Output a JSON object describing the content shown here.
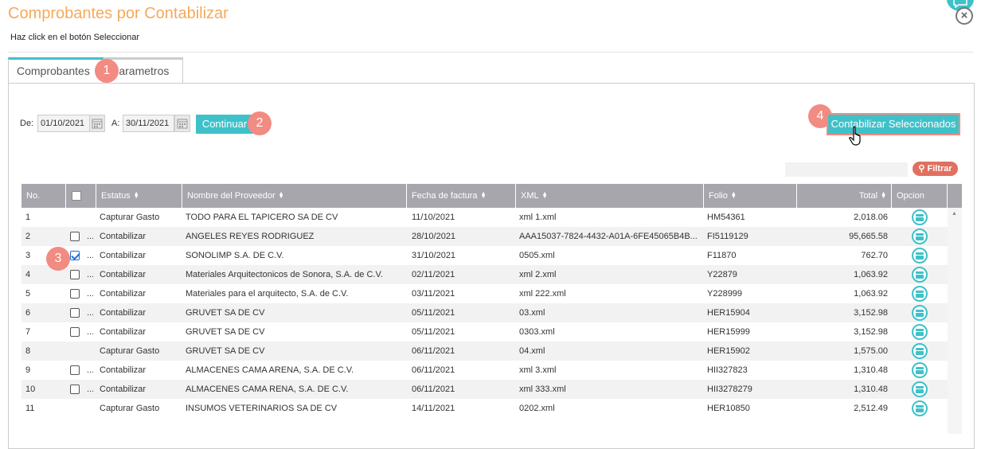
{
  "header": {
    "title": "Comprobantes por Contabilizar",
    "subtitle": "Haz click en el botón Seleccionar",
    "close_glyph": "×"
  },
  "tabs": [
    {
      "label": "Comprobantes",
      "active": true
    },
    {
      "label": "Parametros",
      "active": false
    }
  ],
  "badges": [
    "1",
    "2",
    "3",
    "4"
  ],
  "filters": {
    "from_label": "De:",
    "from_value": "01/10/2021",
    "to_label": "A:",
    "to_value": "30/11/2021",
    "continue_label": "Continuar"
  },
  "actions": {
    "contabilizar_label": "Contabilizar Seleccionados",
    "filter_label": "Filtrar",
    "filter_placeholder": ""
  },
  "table": {
    "columns": [
      "No.",
      "",
      "Estatus",
      "Nombre del Proveedor",
      "Fecha de factura",
      "XML",
      "Folio",
      "Total",
      "Opcion"
    ],
    "rows": [
      {
        "no": "1",
        "checkbox": false,
        "has_checkbox": false,
        "dots": "",
        "estatus": "Capturar Gasto",
        "proveedor": "TODO PARA EL TAPICERO SA DE CV",
        "fecha": "11/10/2021",
        "xml": "xml 1.xml",
        "folio": "HM54361",
        "total": "2,018.06"
      },
      {
        "no": "2",
        "checkbox": false,
        "has_checkbox": true,
        "dots": "...",
        "estatus": "Contabilizar",
        "proveedor": "ANGELES REYES RODRIGUEZ",
        "fecha": "28/10/2021",
        "xml": "AAA15037-7824-4432-A01A-6FE45065B4B...",
        "folio": "FI5119129",
        "total": "95,665.58"
      },
      {
        "no": "3",
        "checkbox": true,
        "has_checkbox": true,
        "dots": "...",
        "estatus": "Contabilizar",
        "proveedor": "SONOLIMP S.A. DE C.V.",
        "fecha": "31/10/2021",
        "xml": "0505.xml",
        "folio": "F11870",
        "total": "762.70"
      },
      {
        "no": "4",
        "checkbox": false,
        "has_checkbox": true,
        "dots": "...",
        "estatus": "Contabilizar",
        "proveedor": "Materiales Arquitectonicos de Sonora, S.A. de C.V.",
        "fecha": "02/11/2021",
        "xml": "xml 2.xml",
        "folio": "Y22879",
        "total": "1,063.92"
      },
      {
        "no": "5",
        "checkbox": false,
        "has_checkbox": true,
        "dots": "...",
        "estatus": "Contabilizar",
        "proveedor": "Materiales para el arquitecto, S.A. de C.V.",
        "fecha": "03/11/2021",
        "xml": "xml 222.xml",
        "folio": "Y228999",
        "total": "1,063.92"
      },
      {
        "no": "6",
        "checkbox": false,
        "has_checkbox": true,
        "dots": "...",
        "estatus": "Contabilizar",
        "proveedor": "GRUVET SA DE CV",
        "fecha": "05/11/2021",
        "xml": "03.xml",
        "folio": "HER15904",
        "total": "3,152.98"
      },
      {
        "no": "7",
        "checkbox": false,
        "has_checkbox": true,
        "dots": "...",
        "estatus": "Contabilizar",
        "proveedor": "GRUVET SA DE CV",
        "fecha": "05/11/2021",
        "xml": "0303.xml",
        "folio": "HER15999",
        "total": "3,152.98"
      },
      {
        "no": "8",
        "checkbox": false,
        "has_checkbox": false,
        "dots": "",
        "estatus": "Capturar Gasto",
        "proveedor": "GRUVET SA DE CV",
        "fecha": "06/11/2021",
        "xml": "04.xml",
        "folio": "HER15902",
        "total": "1,575.00"
      },
      {
        "no": "9",
        "checkbox": false,
        "has_checkbox": true,
        "dots": "...",
        "estatus": "Contabilizar",
        "proveedor": "ALMACENES CAMA ARENA, S.A. DE C.V.",
        "fecha": "06/11/2021",
        "xml": "xml 3.xml",
        "folio": "HII327823",
        "total": "1,310.48"
      },
      {
        "no": "10",
        "checkbox": false,
        "has_checkbox": true,
        "dots": "...",
        "estatus": "Contabilizar",
        "proveedor": "ALMACENES CAMA RENA, S.A. DE C.V.",
        "fecha": "06/11/2021",
        "xml": "xml 333.xml",
        "folio": "HII3278279",
        "total": "1,310.48"
      },
      {
        "no": "11",
        "checkbox": false,
        "has_checkbox": false,
        "dots": "",
        "estatus": "Capturar Gasto",
        "proveedor": "INSUMOS VETERINARIOS SA DE CV",
        "fecha": "14/11/2021",
        "xml": "0202.xml",
        "folio": "HER10850",
        "total": "2,512.49"
      }
    ]
  },
  "colors": {
    "title": "#f5a95b",
    "accent": "#3fc1c9",
    "badge": "#f28b82",
    "filter_button": "#e07060",
    "table_header": "#a7a6ad"
  }
}
